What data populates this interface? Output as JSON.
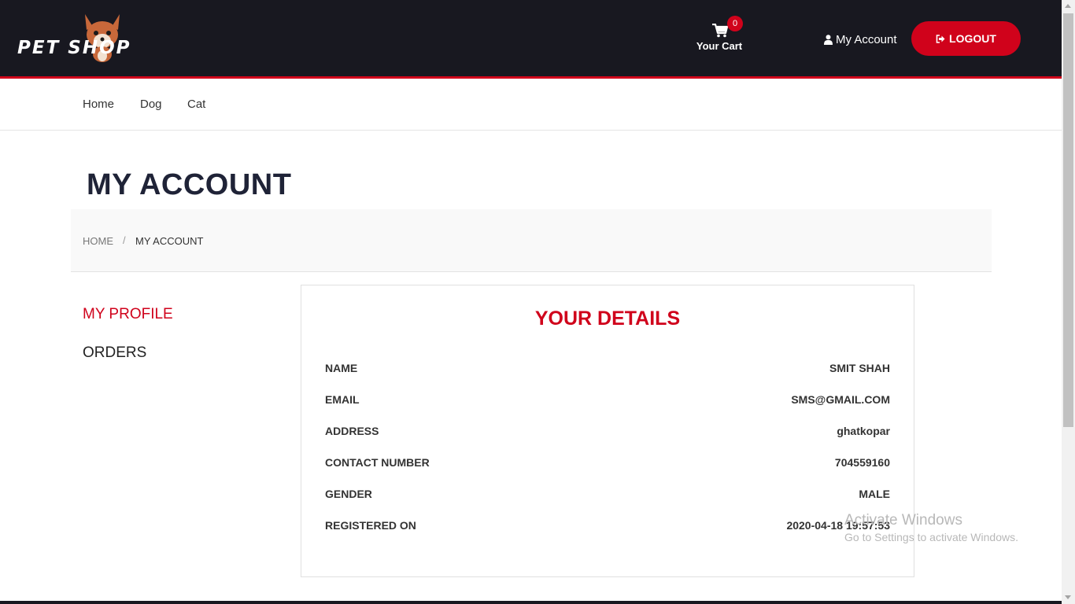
{
  "brand": {
    "logo_text": "PET SHOP",
    "accent_color": "#d0021b",
    "header_bg": "#181820"
  },
  "header": {
    "cart": {
      "label": "Your Cart",
      "count": "0",
      "icon": "shopping-cart-icon"
    },
    "account_label": "My Account",
    "account_icon": "user-icon",
    "logout_label": "LOGOUT",
    "logout_icon": "sign-out-icon"
  },
  "nav": {
    "items": [
      "Home",
      "Dog",
      "Cat"
    ]
  },
  "page": {
    "title": "MY ACCOUNT"
  },
  "breadcrumb": {
    "home": "HOME",
    "separator": "/",
    "current": "MY ACCOUNT"
  },
  "sidebar": {
    "items": [
      "MY PROFILE",
      "ORDERS"
    ],
    "active": "MY PROFILE"
  },
  "details": {
    "title": "YOUR DETAILS",
    "rows": [
      {
        "label": "NAME",
        "value": "SMIT SHAH"
      },
      {
        "label": "EMAIL",
        "value": "SMS@GMAIL.COM"
      },
      {
        "label": "ADDRESS",
        "value": "ghatkopar"
      },
      {
        "label": "CONTACT NUMBER",
        "value": "704559160"
      },
      {
        "label": "GENDER",
        "value": "MALE"
      },
      {
        "label": "REGISTERED ON",
        "value": "2020-04-18 19:57:53"
      }
    ]
  },
  "watermark": {
    "title": "Activate Windows",
    "subtitle": "Go to Settings to activate Windows."
  }
}
